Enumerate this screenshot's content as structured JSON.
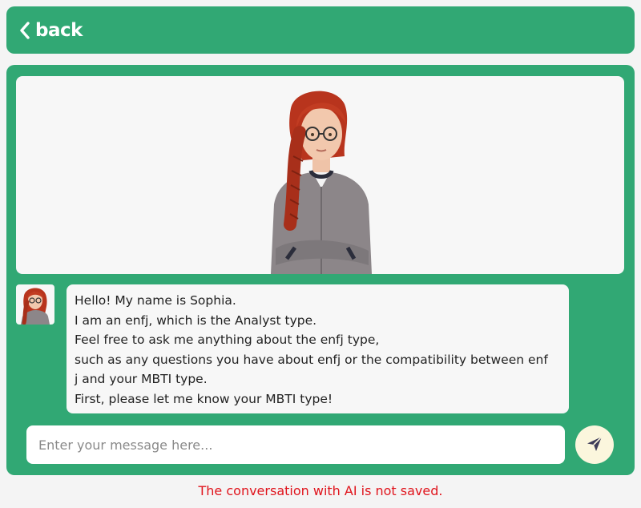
{
  "header": {
    "back_label": "back",
    "back_icon": "chevron-left-icon"
  },
  "character": {
    "portrait": "sophia-portrait",
    "avatar": "sophia-avatar"
  },
  "message": {
    "lines": [
      "Hello! My name is Sophia.",
      "I am an enfj, which is the Analyst type.",
      "Feel free to ask me anything about the enfj type,",
      "such as any questions you have about enfj or the compatibility between enf",
      "j and your MBTI type.",
      "First, please let me know your MBTI type!"
    ]
  },
  "composer": {
    "placeholder": "Enter your message here...",
    "value": "",
    "send_icon": "paper-plane-icon"
  },
  "notice": "The conversation with AI is not saved.",
  "colors": {
    "accent": "#31a874",
    "notice": "#e0141c",
    "send_button": "#fbf6dd"
  }
}
